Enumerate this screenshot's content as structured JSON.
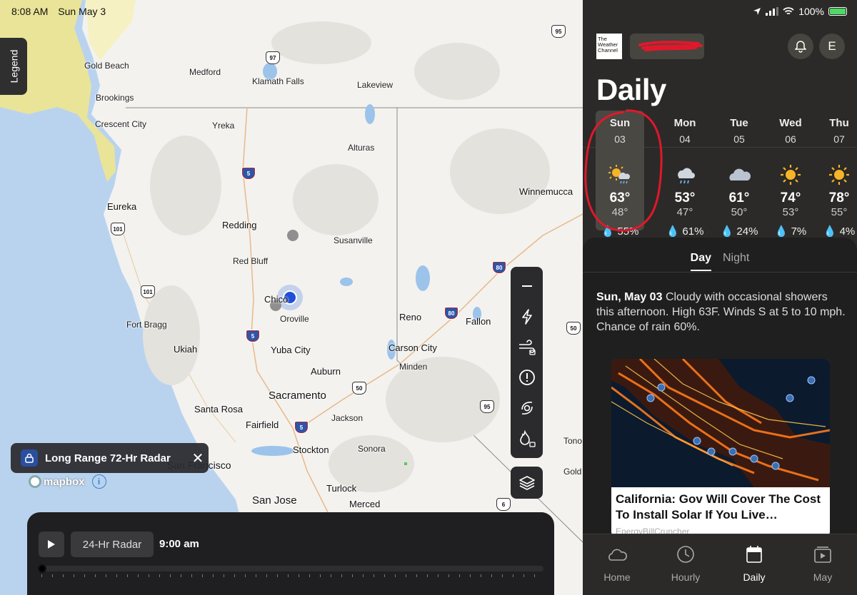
{
  "status": {
    "time": "8:08 AM",
    "date": "Sun May 3",
    "battery": "100%"
  },
  "map": {
    "legend_label": "Legend",
    "radar_pill_label": "Long Range 72-Hr Radar",
    "attribution": "mapbox",
    "cities": [
      {
        "name": "Gold Beach"
      },
      {
        "name": "Medford"
      },
      {
        "name": "Klamath Falls"
      },
      {
        "name": "Lakeview"
      },
      {
        "name": "Brookings"
      },
      {
        "name": "Crescent City"
      },
      {
        "name": "Yreka"
      },
      {
        "name": "Alturas"
      },
      {
        "name": "Winnemucca"
      },
      {
        "name": "Eureka"
      },
      {
        "name": "Redding"
      },
      {
        "name": "Susanville"
      },
      {
        "name": "Red Bluff"
      },
      {
        "name": "Chico"
      },
      {
        "name": "Oroville"
      },
      {
        "name": "Reno"
      },
      {
        "name": "Fallon"
      },
      {
        "name": "Fort Bragg"
      },
      {
        "name": "Ukiah"
      },
      {
        "name": "Yuba City"
      },
      {
        "name": "Carson City"
      },
      {
        "name": "Minden"
      },
      {
        "name": "Auburn"
      },
      {
        "name": "Sacramento"
      },
      {
        "name": "Santa Rosa"
      },
      {
        "name": "Fairfield"
      },
      {
        "name": "Jackson"
      },
      {
        "name": "Stockton"
      },
      {
        "name": "Sonora"
      },
      {
        "name": "San Francisco"
      },
      {
        "name": "Turlock"
      },
      {
        "name": "San Jose"
      },
      {
        "name": "Merced"
      },
      {
        "name": "Tono"
      },
      {
        "name": "Gold"
      }
    ],
    "shields": [
      {
        "label": "95"
      },
      {
        "label": "97"
      },
      {
        "label": "5"
      },
      {
        "label": "101"
      },
      {
        "label": "80"
      },
      {
        "label": "101"
      },
      {
        "label": "80"
      },
      {
        "label": "5"
      },
      {
        "label": "50"
      },
      {
        "label": "50"
      },
      {
        "label": "5"
      },
      {
        "label": "95"
      },
      {
        "label": "6"
      }
    ]
  },
  "timeline": {
    "radar_button": "24-Hr Radar",
    "time": "9:00 am",
    "progress": 0
  },
  "panel": {
    "logo_text": "The Weather Channel",
    "avatar_letter": "E",
    "title": "Daily",
    "days": [
      {
        "name": "Sun",
        "date": "03",
        "icon": "partly-sunny-rain-icon",
        "high": "63°",
        "low": "48°",
        "precip": "55%"
      },
      {
        "name": "Mon",
        "date": "04",
        "icon": "rain-cloud-icon",
        "high": "53°",
        "low": "47°",
        "precip": "61%"
      },
      {
        "name": "Tue",
        "date": "05",
        "icon": "cloudy-icon",
        "high": "61°",
        "low": "50°",
        "precip": "24%"
      },
      {
        "name": "Wed",
        "date": "06",
        "icon": "sunny-icon",
        "high": "74°",
        "low": "53°",
        "precip": "7%"
      },
      {
        "name": "Thu",
        "date": "07",
        "icon": "sunny-icon",
        "high": "78°",
        "low": "55°",
        "precip": "4%"
      }
    ],
    "tab_day": "Day",
    "tab_night": "Night",
    "narrative_lead": "Sun, May 03",
    "narrative_body": "Cloudy with occasional showers this afternoon. High 63F. Winds S at 5 to 10 mph. Chance of rain 60%.",
    "card_title": "California: Gov Will Cover The Cost To Install Solar If You Live…",
    "card_source": "EnergyBillCruncher",
    "nav": [
      {
        "label": "Home",
        "icon": "cloud-icon"
      },
      {
        "label": "Hourly",
        "icon": "clock-icon"
      },
      {
        "label": "Daily",
        "icon": "calendar-icon"
      },
      {
        "label": "May",
        "icon": "video-icon"
      }
    ],
    "colors": {
      "panel_bg": "#2b2a28",
      "accent": "#ffffff",
      "annotation_red": "#e0182b"
    }
  }
}
